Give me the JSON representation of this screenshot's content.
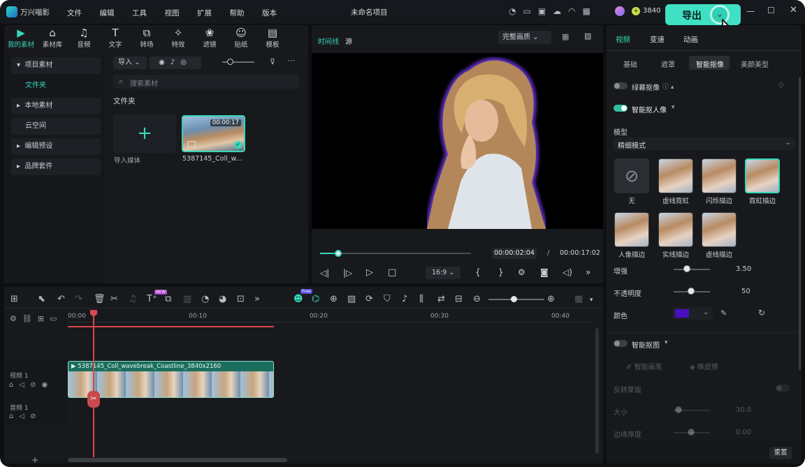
{
  "app": {
    "name": "万兴喵影",
    "project_title": "未命名项目",
    "credits": "3840",
    "export_label": "导出"
  },
  "menu": [
    "文件",
    "编辑",
    "工具",
    "视图",
    "扩展",
    "帮助",
    "版本"
  ],
  "toolbar_tabs": [
    {
      "label": "我的素材",
      "icon": "my-media-icon"
    },
    {
      "label": "素材库",
      "icon": "store-icon"
    },
    {
      "label": "音频",
      "icon": "music-icon"
    },
    {
      "label": "文字",
      "icon": "text-icon"
    },
    {
      "label": "转场",
      "icon": "transition-icon"
    },
    {
      "label": "特效",
      "icon": "effects-icon"
    },
    {
      "label": "滤镜",
      "icon": "filter-icon"
    },
    {
      "label": "贴纸",
      "icon": "sticker-icon"
    },
    {
      "label": "模板",
      "icon": "template-icon"
    }
  ],
  "sidebar": {
    "project_media": "项目素材",
    "folder": "文件夹",
    "local_media": "本地素材",
    "cloud": "云空间",
    "edit_presets": "编辑预设",
    "brand_kit": "品牌套件"
  },
  "media": {
    "import_label": "导入",
    "search_placeholder": "搜索素材",
    "section_title": "文件夹",
    "import_media_label": "导入媒体",
    "clip_name": "5387145_Coll_w...",
    "clip_duration": "00:00:17"
  },
  "preview": {
    "tab_timeline": "时间线",
    "tab_source": "源",
    "quality": "完整画质",
    "current_time": "00:00:02:04",
    "separator": "/",
    "total_time": "00:00:17:02",
    "aspect": "16:9",
    "progress": 0.12
  },
  "right_panel": {
    "tabs": [
      "视频",
      "变速",
      "动画"
    ],
    "subtabs": [
      "基础",
      "遮罩",
      "智能抠像",
      "美颜美型"
    ],
    "chroma_key": "绿幕抠像",
    "ai_portrait": "智能抠人像",
    "model_label": "模型",
    "model_value": "精细模式",
    "effects_row1": [
      "无",
      "虚线霓虹",
      "闪烁描边",
      "霓虹描边"
    ],
    "effects_row2": [
      "人像描边",
      "实线描边",
      "虚线描边"
    ],
    "enhance_label": "增强",
    "enhance_value": "3.50",
    "opacity_label": "不透明度",
    "opacity_value": "50",
    "color_label": "颜色",
    "color_hex": "#4a0fbf",
    "smart_cutout": "智能抠图",
    "smart_brush": "智能画笔",
    "eraser": "橡皮擦",
    "invert_mask": "反转蒙版",
    "size_label": "大小",
    "size_value": "30.0",
    "edge_label": "边缘厚度",
    "edge_value": "0.00",
    "reset": "重置"
  },
  "timeline": {
    "ruler": [
      "00:00",
      "00:10",
      "00:20",
      "00:30",
      "00:40"
    ],
    "video_track": "视频 1",
    "audio_track": "音频 1",
    "clip_label": "5387145_Coll_wavebreak_Coastline_3840x2160",
    "badge_new": "NEW",
    "badge_free": "Free"
  },
  "colors": {
    "accent": "#37d7b8",
    "playhead": "#d9484c",
    "bg": "#0d0f12"
  }
}
